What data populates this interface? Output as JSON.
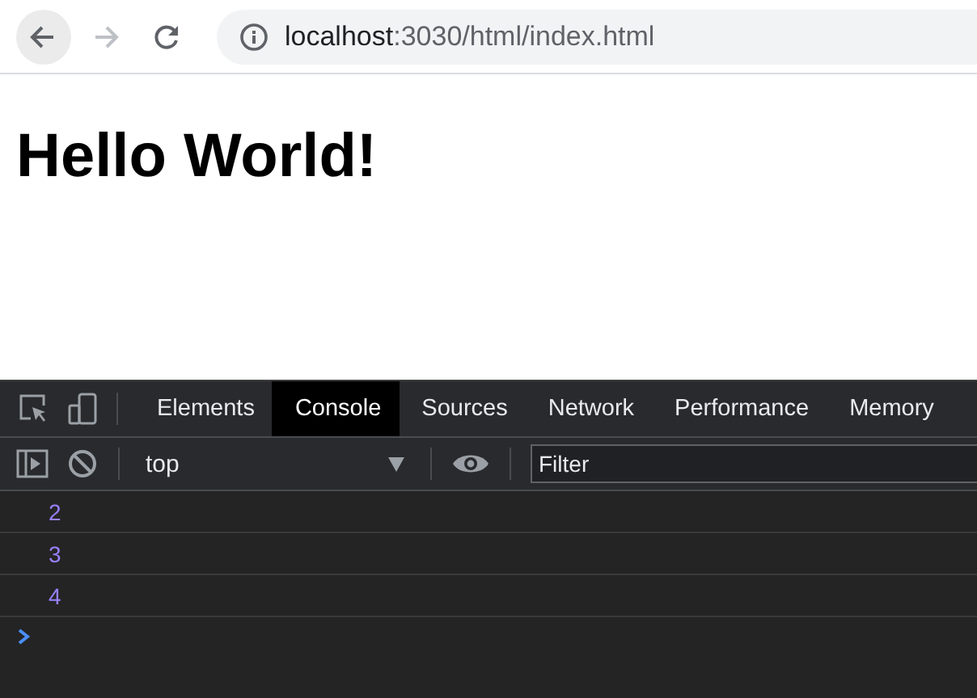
{
  "browser": {
    "url_host": "localhost",
    "url_path": ":3030/html/index.html",
    "back_disabled": false,
    "forward_disabled": true
  },
  "page": {
    "heading": "Hello World!"
  },
  "devtools": {
    "tabs": [
      {
        "label": "Elements",
        "selected": false
      },
      {
        "label": "Console",
        "selected": true
      },
      {
        "label": "Sources",
        "selected": false
      },
      {
        "label": "Network",
        "selected": false
      },
      {
        "label": "Performance",
        "selected": false
      },
      {
        "label": "Memory",
        "selected": false
      }
    ],
    "context": "top",
    "filter": {
      "placeholder": "Filter"
    },
    "messages": [
      {
        "text": "2"
      },
      {
        "text": "3"
      },
      {
        "text": "4"
      }
    ]
  }
}
